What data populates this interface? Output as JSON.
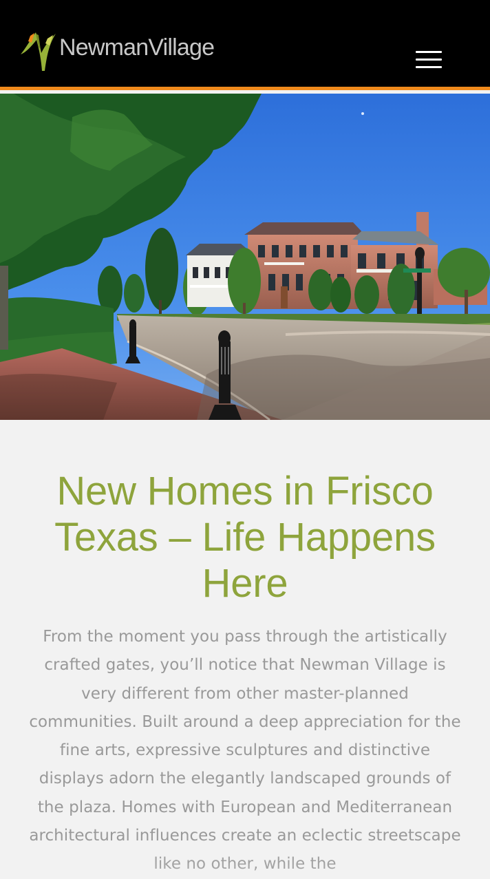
{
  "header": {
    "brand": "NewmanVillage",
    "accent_color": "#f08a1c",
    "menu_icon": "hamburger-menu-icon"
  },
  "hero": {
    "slide_count": 6,
    "active_slide": 3,
    "image_icon": "neighborhood-street-photo"
  },
  "content": {
    "headline": "New Homes in Frisco Texas – Life Happens Here",
    "body": "From the moment you pass through the artistically crafted gates, you’ll notice that Newman Village is very different from other master-planned communities. Built around a deep appreciation for the fine arts, expressive sculptures and distinctive displays adorn the elegantly landscaped grounds of the plaza. Homes with European and Mediterranean architectural influences create an eclectic streetscape like no other, while the"
  },
  "colors": {
    "headline": "#8ea43c",
    "body_text": "#999999",
    "page_background": "#f2f2f2"
  }
}
